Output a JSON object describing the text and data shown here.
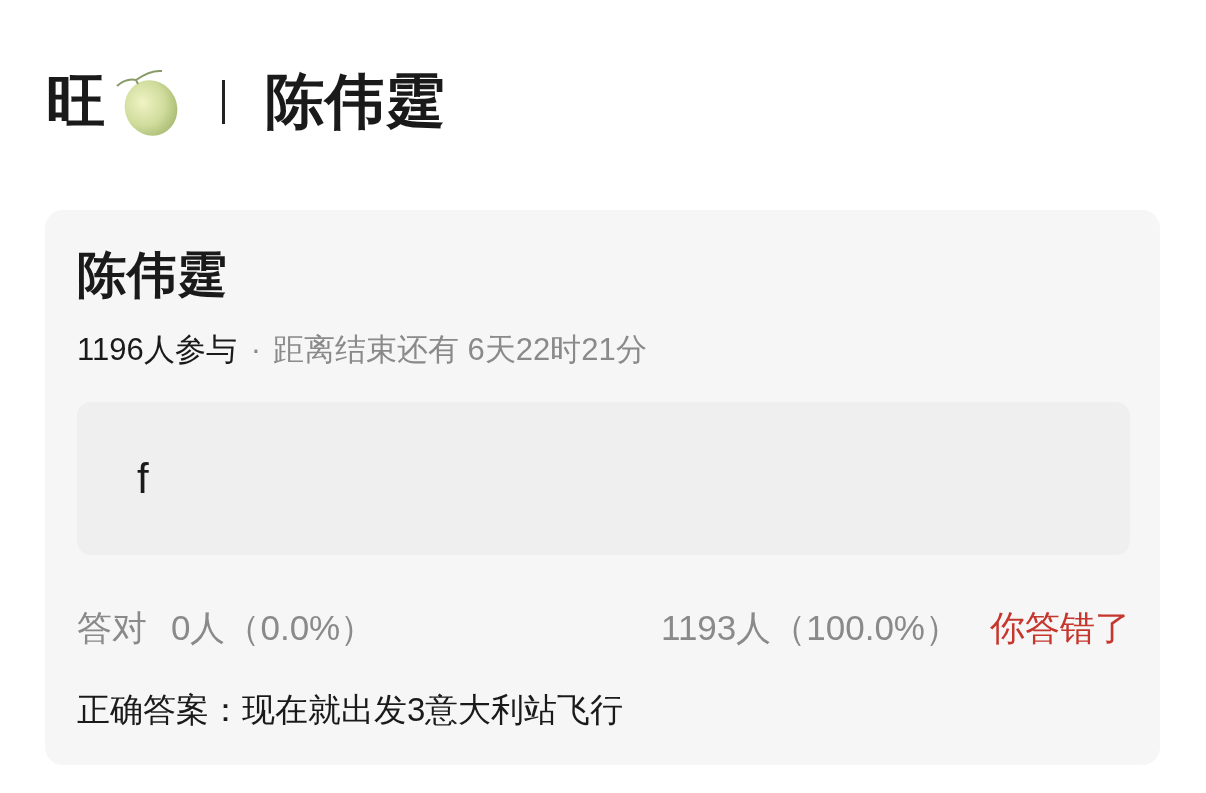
{
  "header": {
    "title": "旺",
    "subtitle": "陈伟霆"
  },
  "quiz": {
    "title": "陈伟霆",
    "participants": "1196人参与",
    "separator": "·",
    "countdown": "距离结束还有 6天22时21分",
    "your_answer": "f",
    "stats": {
      "correct_label": "答对",
      "correct_count": "0人（0.0%）",
      "your_count": "1193人（100.0%）"
    },
    "result": {
      "text": "你答错了",
      "correct": false
    },
    "correct_answer": {
      "label": "正确答案：",
      "value": "现在就出发3意大利站飞行"
    }
  }
}
